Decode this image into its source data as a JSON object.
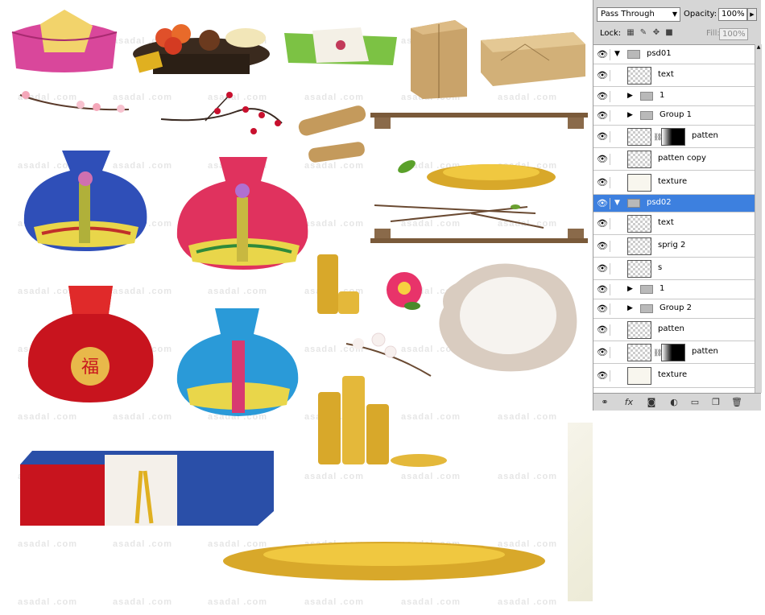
{
  "watermark": "asadal .com",
  "panel": {
    "blend_mode": "Pass Through",
    "opacity_label": "Opacity:",
    "opacity_value": "100%",
    "lock_label": "Lock:",
    "fill_label": "Fill:",
    "fill_value": "100%"
  },
  "layers": [
    {
      "name": "psd01",
      "kind": "group",
      "indent": 0,
      "expanded": true
    },
    {
      "name": "text",
      "kind": "layer",
      "indent": 1
    },
    {
      "name": "1",
      "kind": "group",
      "indent": 1,
      "expanded": false
    },
    {
      "name": "Group 1",
      "kind": "group",
      "indent": 1,
      "expanded": false
    },
    {
      "name": "patten",
      "kind": "masked",
      "indent": 1
    },
    {
      "name": "patten copy",
      "kind": "layer",
      "indent": 1
    },
    {
      "name": "texture",
      "kind": "plain",
      "indent": 1
    },
    {
      "name": "psd02",
      "kind": "group",
      "indent": 0,
      "expanded": true,
      "selected": true
    },
    {
      "name": "text",
      "kind": "layer",
      "indent": 1
    },
    {
      "name": "sprig 2",
      "kind": "layer",
      "indent": 1
    },
    {
      "name": "s",
      "kind": "layer",
      "indent": 1
    },
    {
      "name": "1",
      "kind": "group",
      "indent": 1,
      "expanded": false
    },
    {
      "name": "Group 2",
      "kind": "group",
      "indent": 1,
      "expanded": false
    },
    {
      "name": "patten",
      "kind": "layer",
      "indent": 1
    },
    {
      "name": "patten",
      "kind": "masked",
      "indent": 1
    },
    {
      "name": "texture",
      "kind": "plain",
      "indent": 1
    }
  ],
  "icons": {
    "eye": "eye-icon",
    "link": "link-layers-icon",
    "fx": "layer-style-icon",
    "mask": "add-mask-icon",
    "adjust": "adjustment-layer-icon",
    "group": "new-group-icon",
    "new": "new-layer-icon",
    "delete": "trash-icon"
  }
}
